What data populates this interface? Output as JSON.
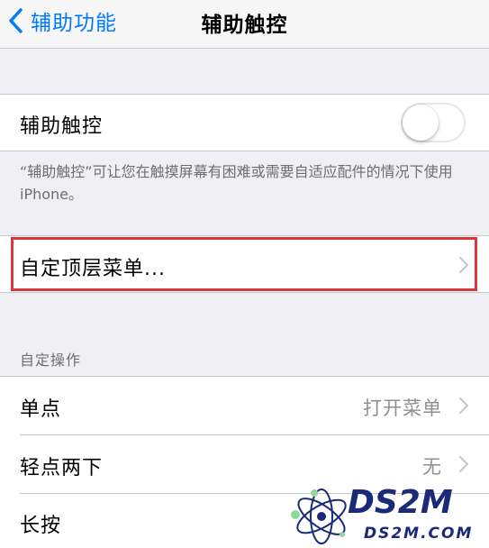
{
  "nav": {
    "back_label": "辅助功能",
    "title": "辅助触控"
  },
  "assistive_touch": {
    "label": "辅助触控",
    "toggle_on": false,
    "footer": "“辅助触控”可让您在触摸屏幕有困难或需要自适应配件的情况下使用 iPhone。"
  },
  "customize_menu": {
    "label": "自定顶层菜单..."
  },
  "custom_actions": {
    "header": "自定操作",
    "items": [
      {
        "label": "单点",
        "value": "打开菜单"
      },
      {
        "label": "轻点两下",
        "value": "无"
      },
      {
        "label": "长按",
        "value": ""
      }
    ]
  },
  "watermark": {
    "brand": "DS2M",
    "domain": "DS2M.COM"
  },
  "colors": {
    "accent": "#007aff",
    "highlight": "#d9363e",
    "background": "#efeff4"
  }
}
